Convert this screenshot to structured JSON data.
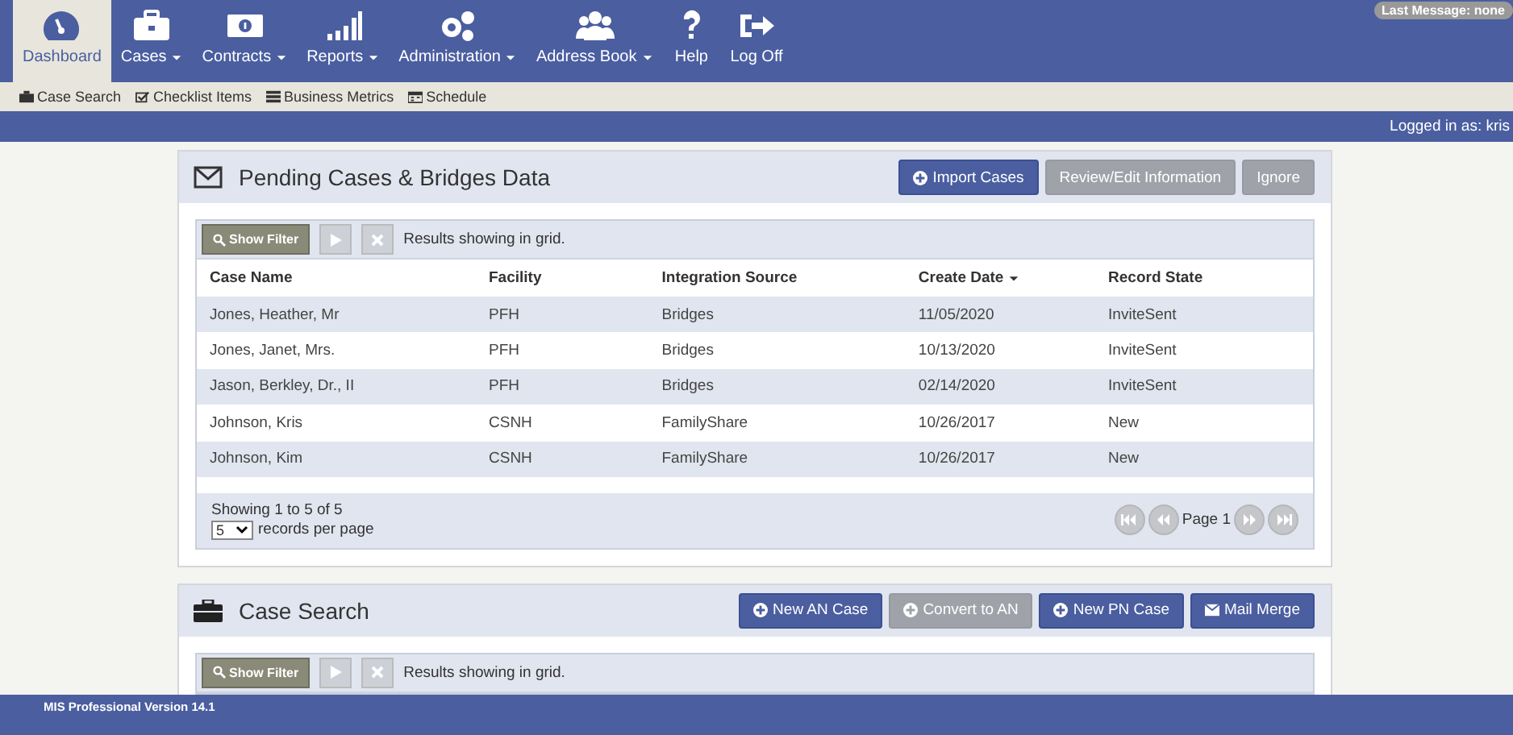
{
  "nav": {
    "items": [
      {
        "label": "Dashboard",
        "selected": true,
        "dropdown": false
      },
      {
        "label": "Cases",
        "selected": false,
        "dropdown": true
      },
      {
        "label": "Contracts",
        "selected": false,
        "dropdown": true
      },
      {
        "label": "Reports",
        "selected": false,
        "dropdown": true
      },
      {
        "label": "Administration",
        "selected": false,
        "dropdown": true
      },
      {
        "label": "Address Book",
        "selected": false,
        "dropdown": true
      },
      {
        "label": "Help",
        "selected": false,
        "dropdown": false
      },
      {
        "label": "Log Off",
        "selected": false,
        "dropdown": false
      }
    ],
    "last_message": "Last Message: none"
  },
  "subnav": {
    "items": [
      "Case Search",
      "Checklist Items",
      "Business Metrics",
      "Schedule"
    ]
  },
  "logged_in": "Logged in as: kris",
  "panels": [
    {
      "title": "Pending Cases & Bridges Data",
      "buttons": [
        {
          "label": "Import Cases",
          "disabled": false,
          "plus": true
        },
        {
          "label": "Review/Edit Information",
          "disabled": true,
          "plus": false
        },
        {
          "label": "Ignore",
          "disabled": true,
          "plus": false
        }
      ],
      "toolbar": {
        "filter": "Show Filter",
        "results": "Results showing in grid."
      },
      "table": {
        "columns": [
          {
            "label": "Case Name",
            "sorted": false
          },
          {
            "label": "Facility",
            "sorted": false
          },
          {
            "label": "Integration Source",
            "sorted": false
          },
          {
            "label": "Create Date",
            "sorted": true
          },
          {
            "label": "Record State",
            "sorted": false
          }
        ],
        "rows": [
          [
            "Jones, Heather, Mr",
            "PFH",
            "Bridges",
            "11/05/2020",
            "InviteSent"
          ],
          [
            "Jones, Janet, Mrs.",
            "PFH",
            "Bridges",
            "10/13/2020",
            "InviteSent"
          ],
          [
            "Jason, Berkley, Dr., II",
            "PFH",
            "Bridges",
            "02/14/2020",
            "InviteSent"
          ],
          [
            "Johnson, Kris",
            "CSNH",
            "FamilyShare",
            "10/26/2017",
            "New"
          ],
          [
            "Johnson, Kim",
            "CSNH",
            "FamilyShare",
            "10/26/2017",
            "New"
          ]
        ]
      },
      "footer": {
        "showing": "Showing 1 to 5 of 5",
        "page_size": "5",
        "per_page": "records per page",
        "page": "Page 1"
      }
    },
    {
      "title": "Case Search",
      "buttons": [
        {
          "label": "New AN Case",
          "disabled": false,
          "plus": true
        },
        {
          "label": "Convert to AN",
          "disabled": true,
          "plus": true
        },
        {
          "label": "New PN Case",
          "disabled": false,
          "plus": true
        },
        {
          "label": "Mail Merge",
          "disabled": false,
          "plus": false
        }
      ],
      "toolbar": {
        "filter": "Show Filter",
        "results": "Results showing in grid."
      }
    }
  ],
  "status_bar": "MIS Professional Version 14.1"
}
